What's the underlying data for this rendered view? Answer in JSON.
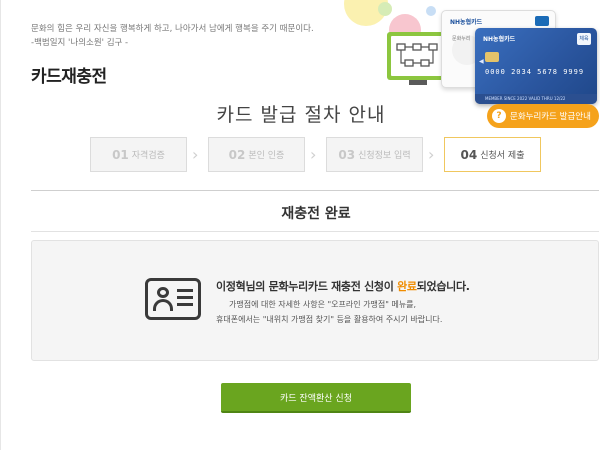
{
  "header": {
    "quote_line1": "문화의 힘은 우리 자신을 행복하게 하고, 나아가서 남에게 행복을 주기 때문이다.",
    "quote_line2": "-백범일지 '나의소원' 김구 -",
    "page_title": "카드재충전"
  },
  "illustration": {
    "card_white_brand": "NH농협카드",
    "card_white_emblem": "문화누리",
    "card_white_tag": "",
    "card_blue_brand": "NH농협카드",
    "card_blue_number": "0000 2034 5678 9999",
    "card_blue_valid": "MEMBER SINCE 2022 VALID THRU 12/22",
    "card_blue_tag": "체육"
  },
  "guide_button": {
    "label": "문화누리카드 발급안내",
    "icon_label": "?"
  },
  "procedure": {
    "title": "카드 발급 절차 안내",
    "steps": [
      {
        "no": "01",
        "label": "자격검증",
        "active": false
      },
      {
        "no": "02",
        "label": "본인 인증",
        "active": false
      },
      {
        "no": "03",
        "label": "신청정보 입력",
        "active": false
      },
      {
        "no": "04",
        "label": "신청서 제출",
        "active": true
      }
    ]
  },
  "result": {
    "section_title": "재충전 완료",
    "msg_prefix": "이정혁님의 문화누리카드 재충전 신청이 ",
    "msg_highlight": "완료",
    "msg_suffix": "되었습니다.",
    "sub_line1": "가맹점에 대한 자세한 사항은 \"오프라인 가맹점\" 메뉴를,",
    "sub_line2": "휴대폰에서는 \"내위치 가맹점 찾기\" 등을 활용하여 주시기 바랍니다."
  },
  "actions": {
    "refund_label": "카드 잔액환산 신청"
  },
  "colors": {
    "accent_orange": "#f5a21b",
    "highlight": "#f08c00",
    "primary_green": "#6aa51f",
    "card_blue": "#2a559e"
  }
}
